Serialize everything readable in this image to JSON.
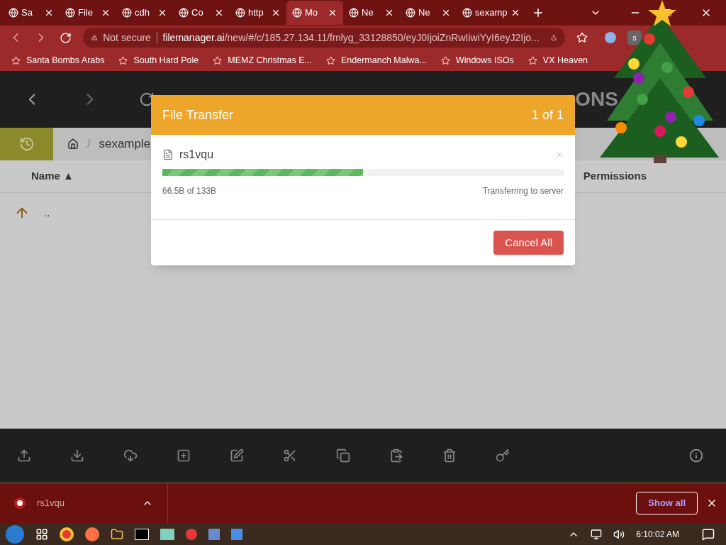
{
  "browser": {
    "tabs": [
      {
        "label": "Sa",
        "selected": false
      },
      {
        "label": "File",
        "selected": false
      },
      {
        "label": "cdh",
        "selected": false
      },
      {
        "label": "Co",
        "selected": false
      },
      {
        "label": "http",
        "selected": false
      },
      {
        "label": "Mo",
        "selected": true
      },
      {
        "label": "Ne",
        "selected": false
      },
      {
        "label": "Ne",
        "selected": false
      },
      {
        "label": "sexamp",
        "selected": false
      }
    ],
    "security": "Not secure",
    "url_host": "filemanager.ai",
    "url_path": "/new/#/c/185.27.134.11/fmlyg_33128850/eyJ0IjoiZnRwIiwiYyI6eyJ2Ijo...",
    "profile_badge": "s",
    "bookmarks": [
      "Santa Bombs Arabs",
      "South Hard Pole",
      "MEMZ Christmas E...",
      "Endermanch Malwa...",
      "Windows ISOs",
      "VX Heaven"
    ]
  },
  "app": {
    "logo": "ONS",
    "breadcrumb_separator": "/",
    "breadcrumb": [
      "sexample"
    ],
    "columns": [
      {
        "label": "Name ▲"
      },
      {
        "label": "Permissions"
      }
    ],
    "rows": [
      {
        "name": ".."
      }
    ]
  },
  "dialog": {
    "title": "File Transfer",
    "counter": "1 of 1",
    "file": "rs1vqu",
    "level": 0.5,
    "progress": "66.5B of 133B",
    "status": "Transferring to server",
    "button": "Cancel All"
  },
  "downloads": {
    "file": "rs1vqu",
    "show_all": "Show all"
  },
  "taskbar": {
    "clock": "6:10:02 AM"
  }
}
